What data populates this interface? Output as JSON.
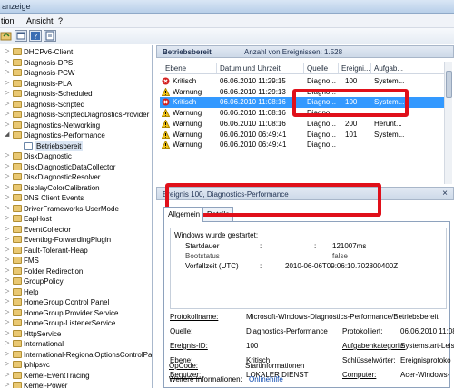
{
  "window": {
    "title": "anzeige"
  },
  "menu": {
    "items": [
      "tion",
      "Ansicht",
      "?"
    ]
  },
  "tree": {
    "items": [
      {
        "label": "DHCPv6-Client",
        "expander": "▷"
      },
      {
        "label": "Diagnosis-DPS",
        "expander": "▷"
      },
      {
        "label": "Diagnosis-PCW",
        "expander": "▷"
      },
      {
        "label": "Diagnosis-PLA",
        "expander": "▷"
      },
      {
        "label": "Diagnosis-Scheduled",
        "expander": "▷"
      },
      {
        "label": "Diagnosis-Scripted",
        "expander": "▷"
      },
      {
        "label": "Diagnosis-ScriptedDiagnosticsProvider",
        "expander": "▷"
      },
      {
        "label": "Diagnostics-Networking",
        "expander": "▷"
      },
      {
        "label": "Diagnostics-Performance",
        "expander": "◢"
      },
      {
        "label": "Betriebsbereit",
        "expander": "",
        "sub": true
      },
      {
        "label": "DiskDiagnostic",
        "expander": "▷"
      },
      {
        "label": "DiskDiagnosticDataCollector",
        "expander": "▷"
      },
      {
        "label": "DiskDiagnosticResolver",
        "expander": "▷"
      },
      {
        "label": "DisplayColorCalibration",
        "expander": "▷"
      },
      {
        "label": "DNS Client Events",
        "expander": "▷"
      },
      {
        "label": "DriverFrameworks-UserMode",
        "expander": "▷"
      },
      {
        "label": "EapHost",
        "expander": "▷"
      },
      {
        "label": "EventCollector",
        "expander": "▷"
      },
      {
        "label": "Eventlog-ForwardingPlugin",
        "expander": "▷"
      },
      {
        "label": "Fault-Tolerant-Heap",
        "expander": "▷"
      },
      {
        "label": "FMS",
        "expander": "▷"
      },
      {
        "label": "Folder Redirection",
        "expander": "▷"
      },
      {
        "label": "GroupPolicy",
        "expander": "▷"
      },
      {
        "label": "Help",
        "expander": "▷"
      },
      {
        "label": "HomeGroup Control Panel",
        "expander": "▷"
      },
      {
        "label": "HomeGroup Provider Service",
        "expander": "▷"
      },
      {
        "label": "HomeGroup-ListenerService",
        "expander": "▷"
      },
      {
        "label": "HttpService",
        "expander": "▷"
      },
      {
        "label": "International",
        "expander": "▷"
      },
      {
        "label": "International-RegionalOptionsControlPa",
        "expander": "▷"
      },
      {
        "label": "lphlpsvc",
        "expander": "▷"
      },
      {
        "label": "Kernel-EventTracing",
        "expander": "▷"
      },
      {
        "label": "Kernel-Power",
        "expander": "▷"
      }
    ]
  },
  "events_header": {
    "title": "Betriebsbereit",
    "count_text": "Anzahl von Ereignissen: 1.528"
  },
  "columns": [
    "Ebene",
    "Datum und Uhrzeit",
    "Quelle",
    "Ereigni...",
    "Aufgab..."
  ],
  "events": [
    {
      "level": "Kritisch",
      "datetime": "06.06.2010 11:29:15",
      "source": "Diagno...",
      "id": "100",
      "task": "System...",
      "icon": "critical-icon",
      "selected": false
    },
    {
      "level": "Warnung",
      "datetime": "06.06.2010 11:29:13",
      "source": "Diagno...",
      "id": "",
      "task": "",
      "icon": "warning-icon",
      "selected": false
    },
    {
      "level": "Kritisch",
      "datetime": "06.06.2010 11:08:16",
      "source": "Diagno...",
      "id": "100",
      "task": "System...",
      "icon": "critical-icon",
      "selected": true
    },
    {
      "level": "Warnung",
      "datetime": "06.06.2010 11:08:16",
      "source": "Diagno...",
      "id": "",
      "task": "",
      "icon": "warning-icon",
      "selected": false
    },
    {
      "level": "Warnung",
      "datetime": "06.06.2010 11:08:16",
      "source": "Diagno...",
      "id": "200",
      "task": "Herunt...",
      "icon": "warning-icon",
      "selected": false
    },
    {
      "level": "Warnung",
      "datetime": "06.06.2010 06:49:41",
      "source": "Diagno...",
      "id": "101",
      "task": "System...",
      "icon": "warning-icon",
      "selected": false
    },
    {
      "level": "Warnung",
      "datetime": "06.06.2010 06:49:41",
      "source": "Diagno...",
      "id": "",
      "task": "",
      "icon": "warning-icon",
      "selected": false
    }
  ],
  "details": {
    "title": "Ereignis 100, Diagnostics-Performance",
    "tabs": [
      "Allgemein",
      "Details"
    ],
    "message": {
      "heading": "Windows wurde gestartet:",
      "rows": [
        {
          "label": "Startdauer",
          "sep": ":",
          "value": "121007ms"
        },
        {
          "label": "Bootstatus",
          "sep": ":",
          "value": "false"
        },
        {
          "label": "Vorfallzeit (UTC)",
          "sep": ":",
          "value": "2010-06-06T09:06:10.702800400Z"
        }
      ]
    },
    "fields": {
      "protokollname_label": "Protokollname:",
      "protokollname_value": "Microsoft-Windows-Diagnostics-Performance/Betriebsbereit",
      "quelle_label": "Quelle:",
      "quelle_value": "Diagnostics-Performance",
      "protokolliert_label": "Protokolliert:",
      "protokolliert_value": "06.06.2010 11:08",
      "ereignis_label": "Ereignis-ID:",
      "ereignis_value": "100",
      "aufgabe_label": "Aufgabenkategorie:",
      "aufgabe_value": "Systemstart-Leis",
      "ebene_label": "Ebene:",
      "ebene_value": "Kritisch",
      "schluessel_label": "Schlüsselwörter:",
      "schluessel_value": "Ereignisprotoko",
      "benutzer_label": "Benutzer:",
      "benutzer_value": "LOKALER DIENST",
      "computer_label": "Computer:",
      "computer_value": "Acer-Windows-",
      "opcode_label": "OpCode:",
      "opcode_value": "Startinformationen",
      "weitere_label": "Weitere Informationen:",
      "weitere_link": "Onlinehilfe"
    }
  },
  "colors": {
    "highlight": "#e0101a",
    "selection": "#3399ff"
  }
}
